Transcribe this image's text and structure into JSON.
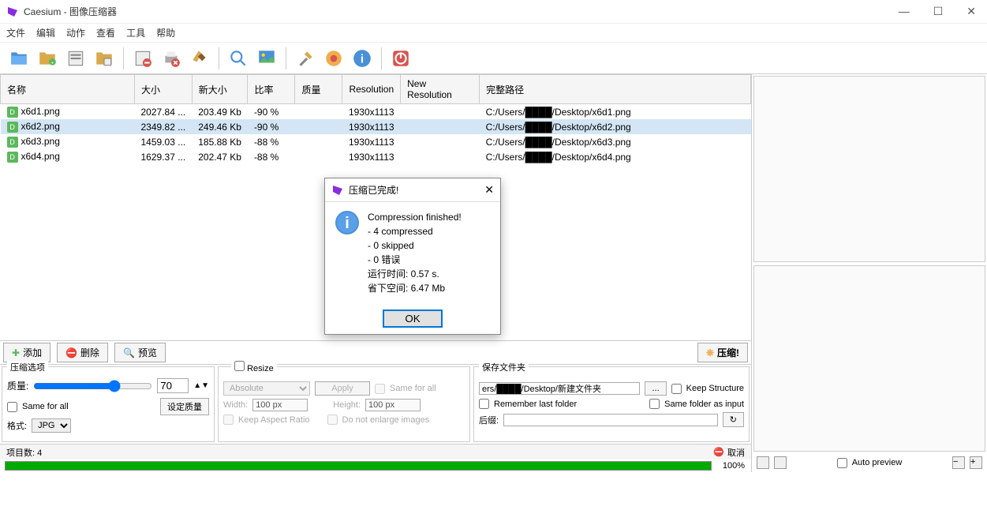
{
  "window": {
    "title": "Caesium - 图像压缩器"
  },
  "menu": [
    "文件",
    "编辑",
    "动作",
    "查看",
    "工具",
    "帮助"
  ],
  "columns": [
    "名称",
    "大小",
    "新大小",
    "比率",
    "质量",
    "Resolution",
    "New Resolution",
    "完整路径"
  ],
  "files": [
    {
      "name": "x6d1.png",
      "size": "2027.84 ...",
      "newsize": "203.49 Kb",
      "ratio": "-90 %",
      "quality": "",
      "res": "1930x1113",
      "newres": "",
      "path": "C:/Users/████/Desktop/x6d1.png"
    },
    {
      "name": "x6d2.png",
      "size": "2349.82 ...",
      "newsize": "249.46 Kb",
      "ratio": "-90 %",
      "quality": "",
      "res": "1930x1113",
      "newres": "",
      "path": "C:/Users/████/Desktop/x6d2.png"
    },
    {
      "name": "x6d3.png",
      "size": "1459.03 ...",
      "newsize": "185.88 Kb",
      "ratio": "-88 %",
      "quality": "",
      "res": "1930x1113",
      "newres": "",
      "path": "C:/Users/████/Desktop/x6d3.png"
    },
    {
      "name": "x6d4.png",
      "size": "1629.37 ...",
      "newsize": "202.47 Kb",
      "ratio": "-88 %",
      "quality": "",
      "res": "1930x1113",
      "newres": "",
      "path": "C:/Users/████/Desktop/x6d4.png"
    }
  ],
  "actions": {
    "add": "添加",
    "delete": "删除",
    "preview": "预览",
    "compress": "压缩!"
  },
  "compress": {
    "legend": "压缩选项",
    "quality_label": "质量:",
    "quality_value": "70",
    "same_all": "Same for all",
    "set_quality": "设定质量",
    "format_label": "格式:",
    "format_value": "JPG"
  },
  "resize": {
    "legend": "Resize",
    "mode": "Absolute",
    "apply": "Apply",
    "same_all": "Same for all",
    "width_label": "Width:",
    "width_value": "100 px",
    "height_label": "Height:",
    "height_value": "100 px",
    "keep_aspect": "Keep Aspect Ratio",
    "no_enlarge": "Do not enlarge images"
  },
  "save": {
    "legend": "保存文件夹",
    "path": "ers/████/Desktop/新建文件夹",
    "browse": "...",
    "keep_structure": "Keep Structure",
    "remember": "Remember last folder",
    "same_folder": "Same folder as input",
    "suffix_label": "后缀:",
    "suffix_value": ""
  },
  "status": {
    "items": "项目数: 4",
    "cancel": "取消",
    "progress": "100%"
  },
  "preview": {
    "auto": "Auto preview"
  },
  "modal": {
    "title": "压缩已完成!",
    "line1": "Compression finished!",
    "line2": "- 4 compressed",
    "line3": "- 0 skipped",
    "line4": "- 0 错误",
    "line5": "运行时间: 0.57 s.",
    "line6": "省下空间: 6.47 Mb",
    "ok": "OK"
  }
}
